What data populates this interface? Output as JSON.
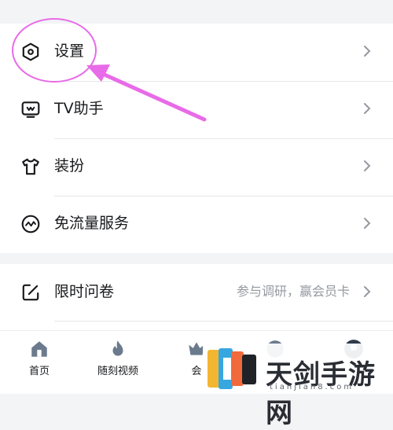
{
  "menu_top": [
    {
      "icon": "hexagon-settings-icon",
      "label": "设置"
    },
    {
      "icon": "tv-icon",
      "label": "TV助手"
    },
    {
      "icon": "tshirt-icon",
      "label": "装扮"
    },
    {
      "icon": "traffic-wave-icon",
      "label": "免流量服务"
    }
  ],
  "menu_bottom": [
    {
      "icon": "edit-square-icon",
      "label": "限时问卷",
      "subtitle": "参与调研，赢会员卡"
    }
  ],
  "tabbar": [
    {
      "icon": "home-icon",
      "label": "首页"
    },
    {
      "icon": "fire-icon",
      "label": "随刻视频"
    },
    {
      "icon": "crown-icon",
      "label": "会"
    },
    {
      "icon": "circle-icon",
      "label": ""
    },
    {
      "icon": "avatar-icon",
      "label": ""
    }
  ],
  "annotation": {
    "color": "#e86be8",
    "target": "设置"
  },
  "watermark": {
    "text": "天剑手游网",
    "sub": "tianjian8.com"
  }
}
